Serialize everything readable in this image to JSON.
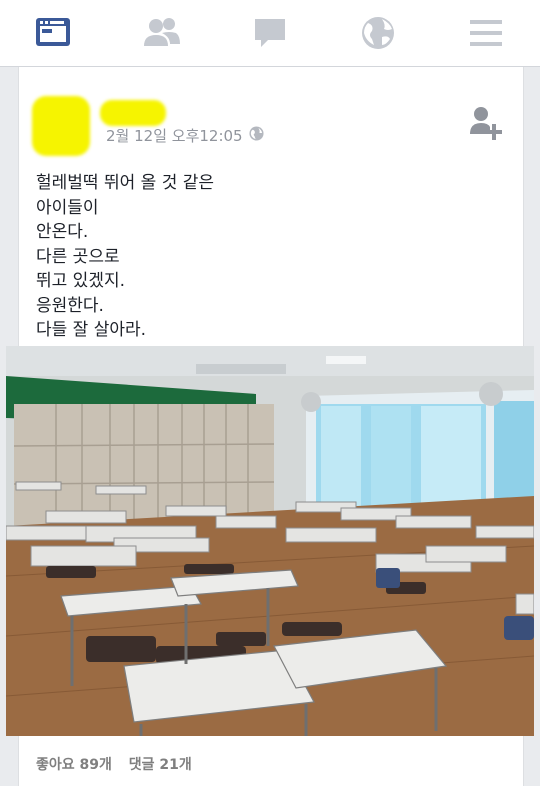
{
  "nav": {
    "items": [
      {
        "name": "news-feed-icon",
        "active": true
      },
      {
        "name": "friends-icon",
        "active": false
      },
      {
        "name": "messages-icon",
        "active": false
      },
      {
        "name": "globe-icon",
        "active": false
      },
      {
        "name": "menu-icon",
        "active": false
      }
    ],
    "active_color": "#3b5998",
    "inactive_color": "#c5c9d0"
  },
  "post": {
    "timestamp": "2월 12일 오후12:05",
    "privacy_icon": "globe-icon",
    "add_friend_icon": "add-friend-icon",
    "text_lines": [
      "헐레벌떡 뛰어 올 것 같은",
      "아이들이",
      "안온다.",
      "다른 곳으로",
      "뛰고 있겠지.",
      "응원한다.",
      "다들 잘 살아라."
    ],
    "photo_description_icon": "classroom-photo"
  },
  "footer": {
    "likes": "좋아요 89개",
    "comments": "댓글 21개"
  },
  "colors": {
    "redaction": "#f6f400",
    "meta_text": "#90949c"
  }
}
